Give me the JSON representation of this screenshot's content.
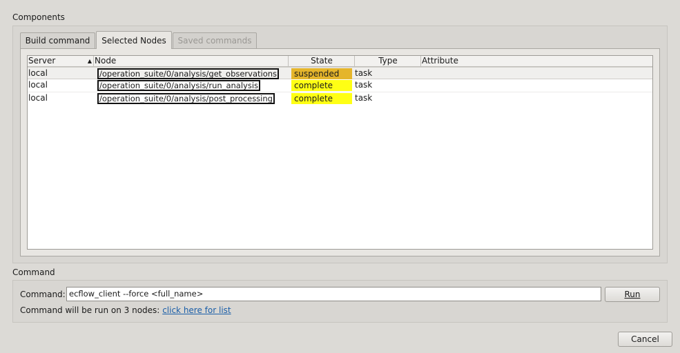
{
  "components": {
    "title": "Components",
    "tabs": [
      {
        "label": "Build command"
      },
      {
        "label": "Selected Nodes"
      },
      {
        "label": "Saved commands"
      }
    ],
    "table": {
      "columns": {
        "server": "Server",
        "node": "Node",
        "state": "State",
        "type": "Type",
        "attribute": "Attribute"
      },
      "sort_indicator": "▲",
      "rows": [
        {
          "server": "local",
          "node": "/operation_suite/0/analysis/get_observations",
          "state": "suspended",
          "state_color": "#e5b52b",
          "type": "task",
          "attribute": ""
        },
        {
          "server": "local",
          "node": "/operation_suite/0/analysis/run_analysis",
          "state": "complete",
          "state_color": "#ffff14",
          "type": "task",
          "attribute": ""
        },
        {
          "server": "local",
          "node": "/operation_suite/0/analysis/post_processing",
          "state": "complete",
          "state_color": "#ffff14",
          "type": "task",
          "attribute": ""
        }
      ]
    }
  },
  "command": {
    "title": "Command",
    "label": "Command:",
    "value": "ecflow_client --force  <full_name>",
    "run_label": "Run",
    "info_text": "Command will be run on 3 nodes:",
    "link_text": "click here for list"
  },
  "footer": {
    "cancel_label": "Cancel"
  }
}
